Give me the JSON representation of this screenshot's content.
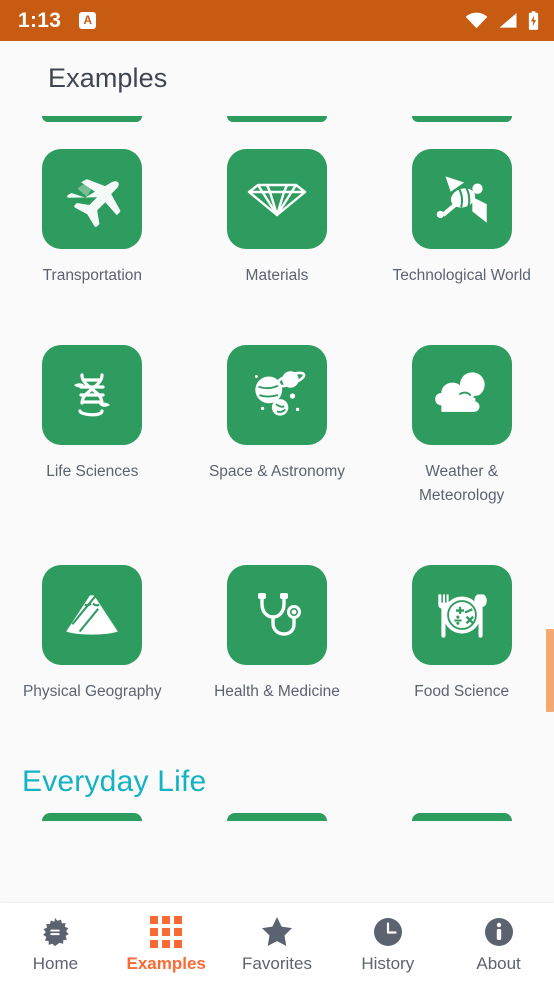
{
  "statusbar": {
    "time": "1:13",
    "app_icon_glyph": "A",
    "app_icon_name": "notification-app-icon",
    "icons": [
      "wifi-icon",
      "cell-signal-icon",
      "battery-charging-icon"
    ],
    "background": "#c75b12"
  },
  "appbar": {
    "title": "Examples"
  },
  "theme": {
    "tile_green": "#2e9b5f",
    "accent_orange": "#f96a35",
    "status_orange": "#c75b12",
    "section_teal": "#11b3c4",
    "label_gray": "#5c6370",
    "background": "#fafafa",
    "scrollbar_thumb": "#f5a971"
  },
  "grid": {
    "rows": [
      [
        {
          "label": "Transportation",
          "icon": "airplane-icon"
        },
        {
          "label": "Materials",
          "icon": "diamond-icon"
        },
        {
          "label": "Technological World",
          "icon": "satellite-icon"
        }
      ],
      [
        {
          "label": "Life Sciences",
          "icon": "dna-icon"
        },
        {
          "label": "Space & Astronomy",
          "icon": "planets-icon"
        },
        {
          "label": "Weather & Meteorology",
          "icon": "cloud-sun-icon"
        }
      ],
      [
        {
          "label": "Physical Geography",
          "icon": "mountains-icon"
        },
        {
          "label": "Health & Medicine",
          "icon": "stethoscope-icon"
        },
        {
          "label": "Food Science",
          "icon": "plate-utensils-icon"
        }
      ]
    ]
  },
  "section": {
    "heading": "Everyday Life"
  },
  "bottom_nav": {
    "items": [
      {
        "label": "Home",
        "icon": "starburst-badge-icon",
        "active": false
      },
      {
        "label": "Examples",
        "icon": "grid-icon",
        "active": true
      },
      {
        "label": "Favorites",
        "icon": "star-icon",
        "active": false
      },
      {
        "label": "History",
        "icon": "clock-icon",
        "active": false
      },
      {
        "label": "About",
        "icon": "info-circle-icon",
        "active": false
      }
    ]
  }
}
